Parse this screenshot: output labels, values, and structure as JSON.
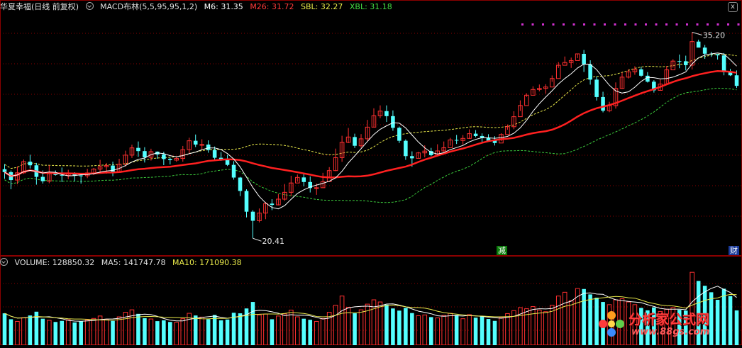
{
  "header": {
    "stock_name": "华夏幸福(日线 前复权)",
    "indicator": "MACD布林(5,5,95,95,1,2)",
    "m6": "M6: 31.35",
    "m26": "M26: 31.72",
    "sbl": "SBL: 32.27",
    "xbl": "XBL: 31.18"
  },
  "volume_header": {
    "volume": "VOLUME: 128850.32",
    "ma5": "MA5: 141747.78",
    "ma10": "MA10: 171090.38"
  },
  "tags": {
    "reduce": "减",
    "finance": "财"
  },
  "close_label": "x",
  "watermark": {
    "text": "分析家公式网",
    "url": "www.88gs.com"
  },
  "colors": {
    "up": "#ff3030",
    "down": "#54ffff",
    "m26": "#ff2020",
    "m6": "#ffffff",
    "sbl": "#e8e84a",
    "xbl": "#3ccc3c",
    "grid": "#8a0000",
    "dots": "#d030d0"
  },
  "chart_data": {
    "type": "candlestick",
    "price_high_label": "35.20",
    "price_low_label": "20.41",
    "y_range": [
      19.2,
      36.6
    ],
    "candles": [
      [
        25.37,
        25.16,
        25.74,
        24.68
      ],
      [
        25.16,
        24.59,
        25.28,
        23.93
      ],
      [
        24.59,
        25.11,
        25.57,
        24.29
      ],
      [
        25.11,
        25.91,
        26.07,
        25.03
      ],
      [
        25.91,
        25.65,
        26.41,
        25.42
      ],
      [
        25.65,
        24.82,
        25.82,
        24.26
      ],
      [
        24.82,
        24.51,
        25.28,
        24.34
      ],
      [
        24.51,
        25.05,
        25.66,
        24.36
      ],
      [
        25.05,
        24.96,
        25.28,
        24.91
      ],
      [
        24.96,
        24.93,
        25.49,
        24.45
      ],
      [
        24.93,
        25.09,
        25.33,
        24.66
      ],
      [
        25.09,
        24.92,
        25.15,
        24.51
      ],
      [
        24.92,
        24.9,
        25.07,
        24.34
      ],
      [
        24.9,
        25.1,
        25.4,
        24.73
      ],
      [
        25.1,
        25.38,
        25.46,
        24.95
      ],
      [
        25.38,
        25.55,
        26.04,
        25.18
      ],
      [
        25.55,
        25.63,
        25.82,
        25.05
      ],
      [
        25.63,
        25.14,
        25.91,
        24.87
      ],
      [
        25.14,
        25.72,
        26.12,
        25.11
      ],
      [
        25.72,
        26.38,
        26.7,
        25.55
      ],
      [
        26.38,
        26.9,
        27.13,
        26.18
      ],
      [
        26.9,
        26.67,
        27.36,
        26.26
      ],
      [
        26.67,
        26.22,
        26.95,
        25.85
      ],
      [
        26.22,
        26.63,
        26.84,
        25.99
      ],
      [
        26.63,
        26.43,
        26.65,
        26.12
      ],
      [
        26.43,
        26.1,
        26.62,
        25.66
      ],
      [
        26.1,
        26.02,
        26.2,
        25.71
      ],
      [
        26.02,
        26.14,
        26.29,
        25.9
      ],
      [
        26.14,
        26.77,
        27.04,
        25.91
      ],
      [
        26.77,
        27.41,
        27.63,
        26.46
      ],
      [
        27.41,
        27.14,
        27.86,
        26.96
      ],
      [
        27.14,
        27.14,
        27.52,
        26.74
      ],
      [
        27.14,
        26.75,
        27.44,
        26.55
      ],
      [
        26.75,
        26.19,
        27.0,
        25.98
      ],
      [
        26.19,
        26.04,
        26.6,
        25.97
      ],
      [
        26.04,
        25.68,
        26.39,
        25.6
      ],
      [
        25.68,
        24.77,
        25.95,
        24.62
      ],
      [
        24.77,
        23.81,
        24.82,
        23.44
      ],
      [
        23.81,
        22.32,
        23.93,
        21.91
      ],
      [
        22.32,
        21.67,
        22.43,
        20.41
      ],
      [
        21.67,
        22.22,
        22.55,
        21.55
      ],
      [
        22.22,
        22.9,
        23.02,
        21.78
      ],
      [
        22.9,
        22.81,
        23.22,
        22.43
      ],
      [
        22.81,
        23.22,
        23.59,
        22.77
      ],
      [
        23.22,
        23.71,
        24.31,
        23.1
      ],
      [
        23.71,
        24.38,
        24.9,
        23.43
      ],
      [
        24.38,
        24.78,
        24.99,
        24.47
      ],
      [
        24.78,
        24.45,
        25.08,
        24.14
      ],
      [
        24.45,
        24.02,
        24.85,
        23.7
      ],
      [
        24.02,
        24.04,
        24.34,
        23.53
      ],
      [
        24.04,
        24.48,
        25.11,
        24.05
      ],
      [
        24.48,
        25.27,
        25.52,
        24.8
      ],
      [
        25.27,
        26.2,
        26.85,
        25.23
      ],
      [
        26.2,
        27.3,
        27.77,
        25.9
      ],
      [
        27.3,
        27.68,
        28.33,
        27.24
      ],
      [
        27.68,
        27.05,
        27.92,
        26.89
      ],
      [
        27.05,
        27.55,
        27.89,
        26.91
      ],
      [
        27.55,
        28.39,
        28.91,
        27.37
      ],
      [
        28.39,
        29.21,
        29.74,
        28.39
      ],
      [
        29.21,
        29.54,
        29.95,
        29.03
      ],
      [
        29.54,
        29.18,
        29.95,
        28.76
      ],
      [
        29.18,
        28.34,
        29.59,
        28.13
      ],
      [
        28.34,
        27.41,
        28.43,
        27.25
      ],
      [
        27.41,
        26.31,
        27.51,
        26.04
      ],
      [
        26.31,
        26.15,
        26.65,
        25.55
      ],
      [
        26.15,
        26.54,
        26.62,
        26.18
      ],
      [
        26.54,
        26.67,
        27.08,
        26.22
      ],
      [
        26.67,
        26.38,
        26.9,
        26.3
      ],
      [
        26.38,
        26.68,
        27.16,
        26.28
      ],
      [
        26.68,
        26.91,
        27.36,
        26.62
      ],
      [
        26.91,
        27.47,
        27.62,
        27.06
      ],
      [
        27.47,
        27.43,
        27.83,
        27.18
      ],
      [
        27.43,
        27.58,
        27.82,
        27.14
      ],
      [
        27.58,
        27.92,
        28.23,
        27.55
      ],
      [
        27.92,
        27.75,
        28.18,
        27.66
      ],
      [
        27.75,
        27.63,
        27.94,
        27.27
      ],
      [
        27.63,
        27.42,
        27.88,
        27.34
      ],
      [
        27.42,
        27.25,
        27.74,
        27.07
      ],
      [
        27.25,
        27.86,
        27.95,
        27.38
      ],
      [
        27.86,
        28.42,
        28.58,
        28.2
      ],
      [
        28.42,
        29.14,
        29.53,
        28.24
      ],
      [
        29.14,
        29.94,
        30.31,
        29.55
      ],
      [
        29.94,
        30.68,
        30.82,
        30.56
      ],
      [
        30.68,
        31.09,
        31.32,
        30.78
      ],
      [
        31.09,
        31.17,
        31.45,
        30.96
      ],
      [
        31.17,
        31.27,
        31.47,
        30.8
      ],
      [
        31.27,
        31.88,
        32.1,
        31.64
      ],
      [
        31.88,
        32.83,
        33.06,
        32.64
      ],
      [
        32.83,
        33.03,
        33.46,
        32.95
      ],
      [
        33.03,
        33.17,
        33.38,
        32.64
      ],
      [
        33.17,
        33.65,
        33.66,
        33.34
      ],
      [
        33.65,
        32.9,
        33.93,
        32.35
      ],
      [
        32.9,
        31.8,
        33.19,
        31.44
      ],
      [
        31.8,
        30.55,
        32.03,
        30.3
      ],
      [
        30.55,
        29.57,
        30.93,
        29.45
      ],
      [
        29.57,
        29.93,
        30.21,
        29.46
      ],
      [
        29.93,
        31.17,
        31.6,
        29.72
      ],
      [
        31.17,
        31.98,
        32.32,
        31.14
      ],
      [
        31.98,
        32.36,
        32.56,
        31.88
      ],
      [
        32.36,
        32.54,
        32.76,
        32.15
      ],
      [
        32.54,
        32.08,
        32.71,
        32.0
      ],
      [
        32.08,
        31.65,
        32.34,
        31.59
      ],
      [
        31.65,
        31.03,
        31.76,
        30.87
      ],
      [
        31.03,
        31.48,
        31.82,
        31.05
      ],
      [
        31.48,
        32.5,
        32.78,
        31.45
      ],
      [
        32.5,
        33.13,
        33.26,
        32.66
      ],
      [
        33.13,
        33.12,
        33.6,
        32.62
      ],
      [
        33.12,
        32.84,
        33.52,
        32.46
      ],
      [
        32.84,
        34.53,
        35.2,
        32.53
      ],
      [
        34.53,
        34.1,
        34.67,
        34.15
      ],
      [
        34.1,
        33.66,
        34.29,
        33.29
      ],
      [
        33.66,
        33.63,
        33.8,
        33.43
      ],
      [
        33.63,
        33.54,
        33.61,
        33.24
      ],
      [
        33.54,
        32.33,
        33.71,
        32.11
      ],
      [
        32.33,
        32.11,
        32.57,
        32.06
      ],
      [
        32.11,
        31.35,
        32.46,
        31.2
      ]
    ],
    "volumes": [
      118000,
      96000,
      88000,
      102000,
      110000,
      124000,
      98000,
      92000,
      86000,
      90000,
      94000,
      84000,
      88000,
      93000,
      99000,
      108000,
      96000,
      90000,
      105000,
      122000,
      131000,
      116000,
      100000,
      97000,
      89000,
      92000,
      86000,
      85000,
      98000,
      118000,
      110000,
      104000,
      96000,
      112000,
      92000,
      95000,
      120000,
      118000,
      136000,
      160000,
      112000,
      115000,
      96000,
      108000,
      116000,
      130000,
      105000,
      98000,
      94000,
      88000,
      99000,
      122000,
      148000,
      182000,
      140000,
      118000,
      131000,
      152000,
      168000,
      160000,
      150000,
      136000,
      128000,
      138000,
      119000,
      109000,
      112000,
      104000,
      101000,
      110000,
      118000,
      112000,
      98000,
      113000,
      102000,
      108000,
      97000,
      90000,
      102000,
      117000,
      128000,
      139000,
      135000,
      143000,
      130000,
      124000,
      148000,
      182000,
      196000,
      165000,
      210000,
      208000,
      188000,
      176000,
      160000,
      150000,
      168000,
      172000,
      160000,
      150000,
      138000,
      129000,
      140000,
      125000,
      133000,
      139000,
      131000,
      128000,
      270000,
      238000,
      220000,
      196000,
      168000,
      209000,
      182000,
      128850
    ]
  }
}
